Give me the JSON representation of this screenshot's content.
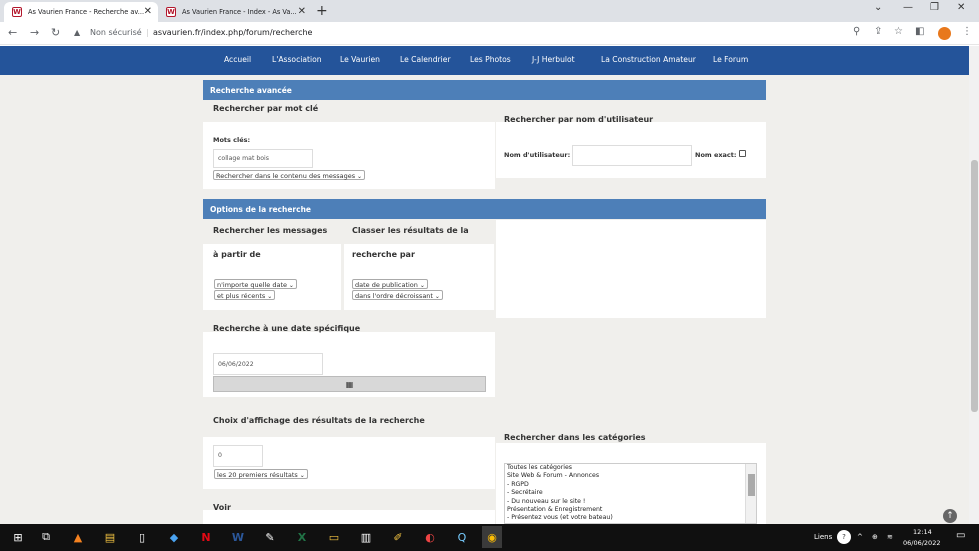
{
  "browser": {
    "tabs": [
      {
        "title": "As Vaurien France - Recherche av..."
      },
      {
        "title": "As Vaurien France - Index - As Va..."
      }
    ],
    "new_tab": "+",
    "security": "Non sécurisé",
    "url": "asvaurien.fr/index.php/forum/recherche"
  },
  "menu": {
    "items": [
      "Accueil",
      "L'Association",
      "Le Vaurien",
      "Le Calendrier",
      "Les Photos",
      "J-J Herbulot",
      "La Construction Amateur",
      "Le Forum"
    ]
  },
  "search": {
    "section_title": "Recherche avancée",
    "keyword_header": "Rechercher par mot clé",
    "keyword_label": "Mots clés:",
    "keyword_value": "collage mat bois",
    "keyword_scope": "Rechercher dans le contenu des messages",
    "user_header": "Rechercher par nom d'utilisateur",
    "user_label": "Nom d'utilisateur:",
    "user_value": "",
    "exact_label": "Nom exact:"
  },
  "options": {
    "section_title": "Options de la recherche",
    "messages_header_1": "Rechercher les messages",
    "messages_header_2": "à partir de",
    "date_select": "n'importe quelle date",
    "date_dir_select": "et plus récents",
    "sort_header_1": "Classer les résultats de la",
    "sort_header_2": "recherche par",
    "sort_select": "date de publication",
    "order_select": "dans l'ordre décroissant",
    "specific_header": "Recherche à une date spécifique",
    "specific_date": "06/06/2022",
    "display_header": "Choix d'affichage des résultats de la recherche",
    "display_start": "0",
    "display_count": "les 20 premiers résultats",
    "categories_header": "Rechercher dans les catégories",
    "categories": [
      "Toutes les catégories",
      "Site Web & Forum - Annonces",
      "- RGPD",
      "- Secrétaire",
      "- Du nouveau sur le site !",
      "Présentation & Enregistrement",
      "- Présentez vous (et votre bateau)"
    ],
    "voir_header": "Voir"
  },
  "taskbar": {
    "liens": "Liens",
    "time": "12:14",
    "date": "06/06/2022"
  }
}
